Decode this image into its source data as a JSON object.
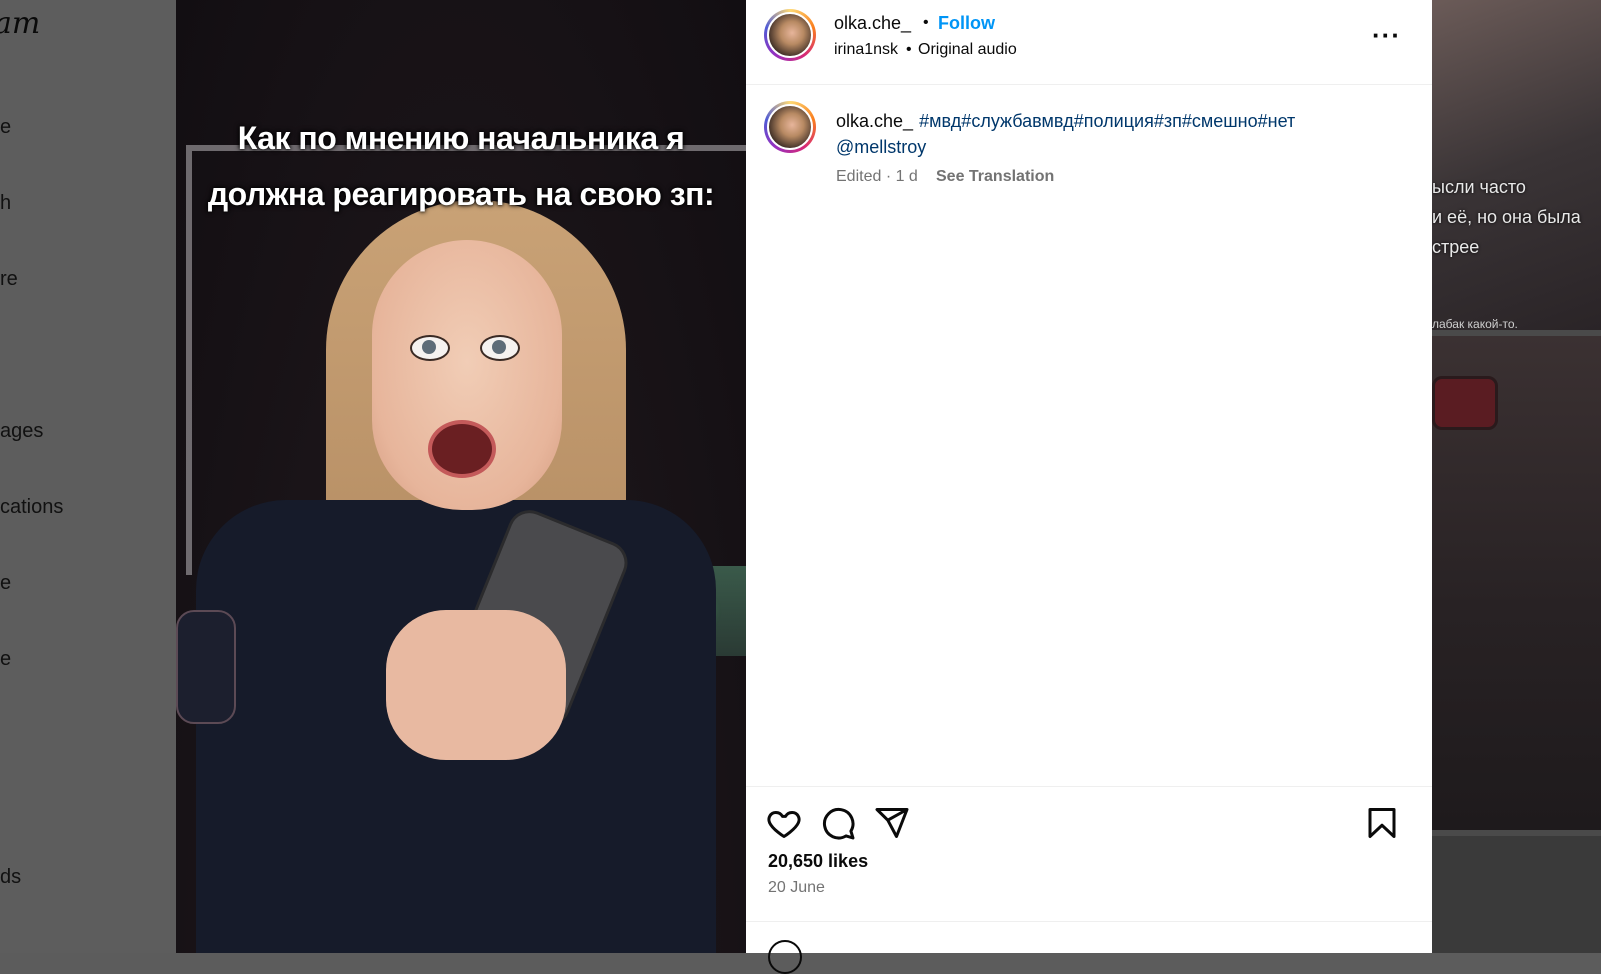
{
  "sidebar": {
    "logo_fragment": "am",
    "items": [
      {
        "label": "e"
      },
      {
        "label": "h"
      },
      {
        "label": "re"
      },
      {
        "label": "ages"
      },
      {
        "label": "cations"
      },
      {
        "label": "e"
      },
      {
        "label": "e"
      },
      {
        "label": "ds"
      }
    ]
  },
  "video": {
    "caption_line1": "Как по мнению начальника я",
    "caption_line2": "должна реагировать на свою зп:"
  },
  "post": {
    "header": {
      "username": "olka.che_",
      "separator": "•",
      "follow_label": "Follow",
      "audio_user": "irina1nsk",
      "audio_sep": "•",
      "audio_label": "Original audio",
      "more_label": "···"
    },
    "caption": {
      "username": "olka.che_",
      "hashtags": "#мвд#службавмвд#полиция#зп#смешно#нет",
      "mention": "@mellstroy",
      "meta": "Edited · 1 d",
      "see_translation": "See Translation"
    },
    "actions": {
      "icons": [
        "heart-icon",
        "comment-icon",
        "share-icon",
        "bookmark-icon"
      ],
      "likes": "20,650 likes",
      "date": "20 June"
    }
  },
  "right_thumbs": {
    "thumb1_lines": [
      "ысли часто",
      "и её, но она была",
      "стрее"
    ],
    "thumb1_small": "лабак какой-то."
  },
  "colors": {
    "follow": "#0095f6",
    "link": "#00376b",
    "muted": "#737373"
  }
}
